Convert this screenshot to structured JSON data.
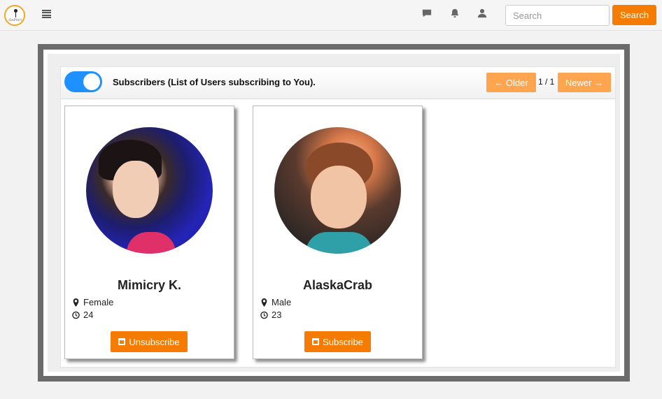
{
  "navbar": {
    "logo_text": "GoPin!!",
    "icons": [
      "menu-icon",
      "chat-icon",
      "bell-icon",
      "user-icon"
    ],
    "search": {
      "placeholder": "Search",
      "value": "",
      "button_label": "Search"
    }
  },
  "panel": {
    "title": "Subscribers (List of Users subscribing to You).",
    "toggle_on": true,
    "pager": {
      "older_label": "← Older",
      "page": "1 / 1",
      "newer_label": "Newer →"
    }
  },
  "users": [
    {
      "name": "Mimicry K.",
      "gender": "Female",
      "age": "24",
      "action_label": "Unsubscribe"
    },
    {
      "name": "AlaskaCrab",
      "gender": "Male",
      "age": "23",
      "action_label": "Subscribe"
    }
  ],
  "colors": {
    "accent": "#f57c00",
    "pager_button": "#ffa54f",
    "toggle": "#1e90ff",
    "frame": "#6b6b6b"
  }
}
